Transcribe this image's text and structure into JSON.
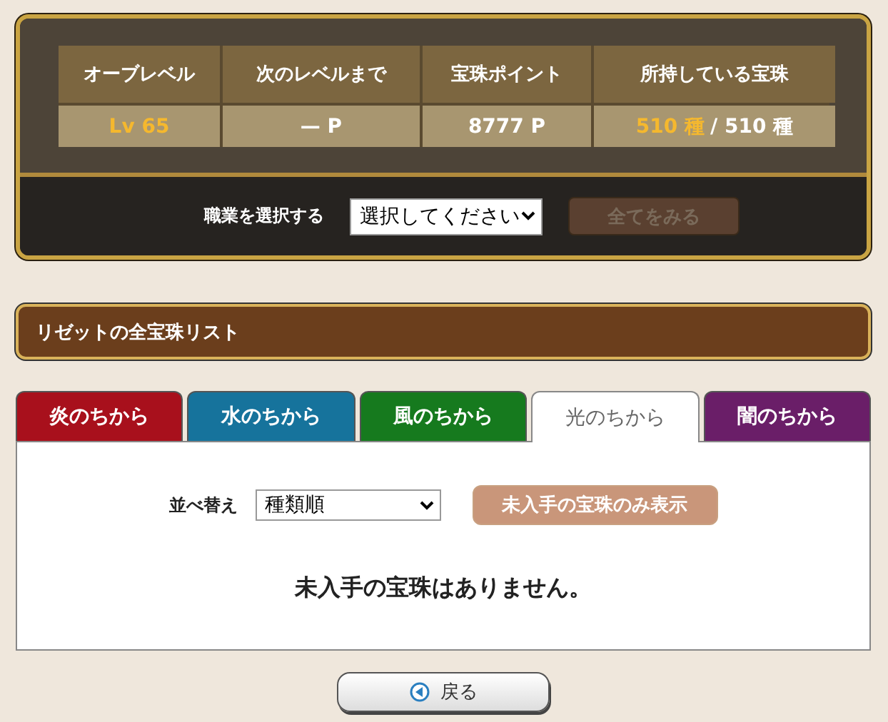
{
  "stats": {
    "headers": [
      "オーブレベル",
      "次のレベルまで",
      "宝珠ポイント",
      "所持している宝珠"
    ],
    "level": "Lv 65",
    "next_level": "— P",
    "points": "8777 P",
    "owned": "510 種",
    "total": "/ 510 種"
  },
  "job_select": {
    "label": "職業を選択する",
    "value": "選択してください",
    "button": {
      "label": "全てをみる",
      "disabled": true
    }
  },
  "section_title": "リゼットの全宝珠リスト",
  "tabs": [
    {
      "label": "炎のちから",
      "selected": false,
      "color": "#a8101c"
    },
    {
      "label": "水のちから",
      "selected": false,
      "color": "#16739c"
    },
    {
      "label": "風のちから",
      "selected": false,
      "color": "#167a1e"
    },
    {
      "label": "光のちから",
      "selected": true
    },
    {
      "label": "闇のちから",
      "selected": false,
      "color": "#6a1e68"
    }
  ],
  "sort": {
    "label": "並べ替え",
    "value": "種類順",
    "button": {
      "label": "未入手の宝珠のみ表示",
      "disabled": true
    }
  },
  "message": "未入手の宝珠はありません。",
  "back_button": "戻る"
}
